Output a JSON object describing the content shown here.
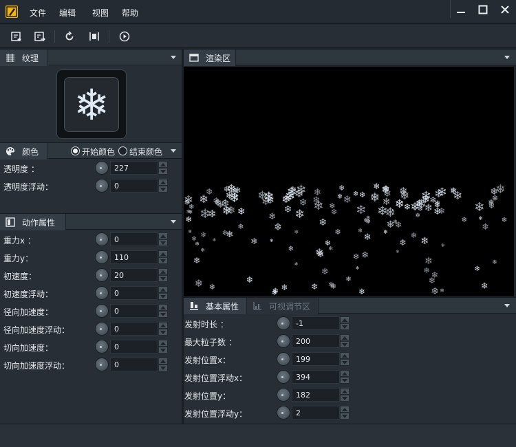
{
  "menu": {
    "file": "文件",
    "edit": "编辑",
    "view": "视图",
    "help": "帮助"
  },
  "window_controls": {
    "minimize": "—",
    "maximize": "☐",
    "close": "✕"
  },
  "texture_panel": {
    "title": "纹理"
  },
  "color_panel": {
    "title": "颜色",
    "start_color_label": "开始颜色",
    "end_color_label": "结束颜色",
    "start_selected": true,
    "rows": [
      {
        "label": "透明度 ：",
        "value": "227"
      },
      {
        "label": "透明度浮动：",
        "value": "0"
      }
    ]
  },
  "motion_panel": {
    "title": "动作属性",
    "rows": [
      {
        "label": "重力x ：",
        "value": "0"
      },
      {
        "label": "重力y：",
        "value": "110"
      },
      {
        "label": "初速度：",
        "value": "20"
      },
      {
        "label": "初速度浮动：",
        "value": "0"
      },
      {
        "label": "径向加速度：",
        "value": "0"
      },
      {
        "label": "径向加速度浮动：",
        "value": "0"
      },
      {
        "label": "切向加速度：",
        "value": "0"
      },
      {
        "label": "切向加速度浮动：",
        "value": "0"
      }
    ]
  },
  "render_panel": {
    "title": "渲染区"
  },
  "basic_panel": {
    "tab_basic": "基本属性",
    "tab_visual": "可视调节区",
    "rows": [
      {
        "label": "发射时长 ：",
        "value": "-1"
      },
      {
        "label": "最大粒子数 ：",
        "value": "200"
      },
      {
        "label": "发射位置x：",
        "value": "199"
      },
      {
        "label": "发射位置浮动x：",
        "value": "394"
      },
      {
        "label": "发射位置y：",
        "value": "182"
      },
      {
        "label": "发射位置浮动y：",
        "value": "2"
      }
    ]
  },
  "icons": {
    "snowflake": "❄",
    "accent": "#f2b705"
  }
}
